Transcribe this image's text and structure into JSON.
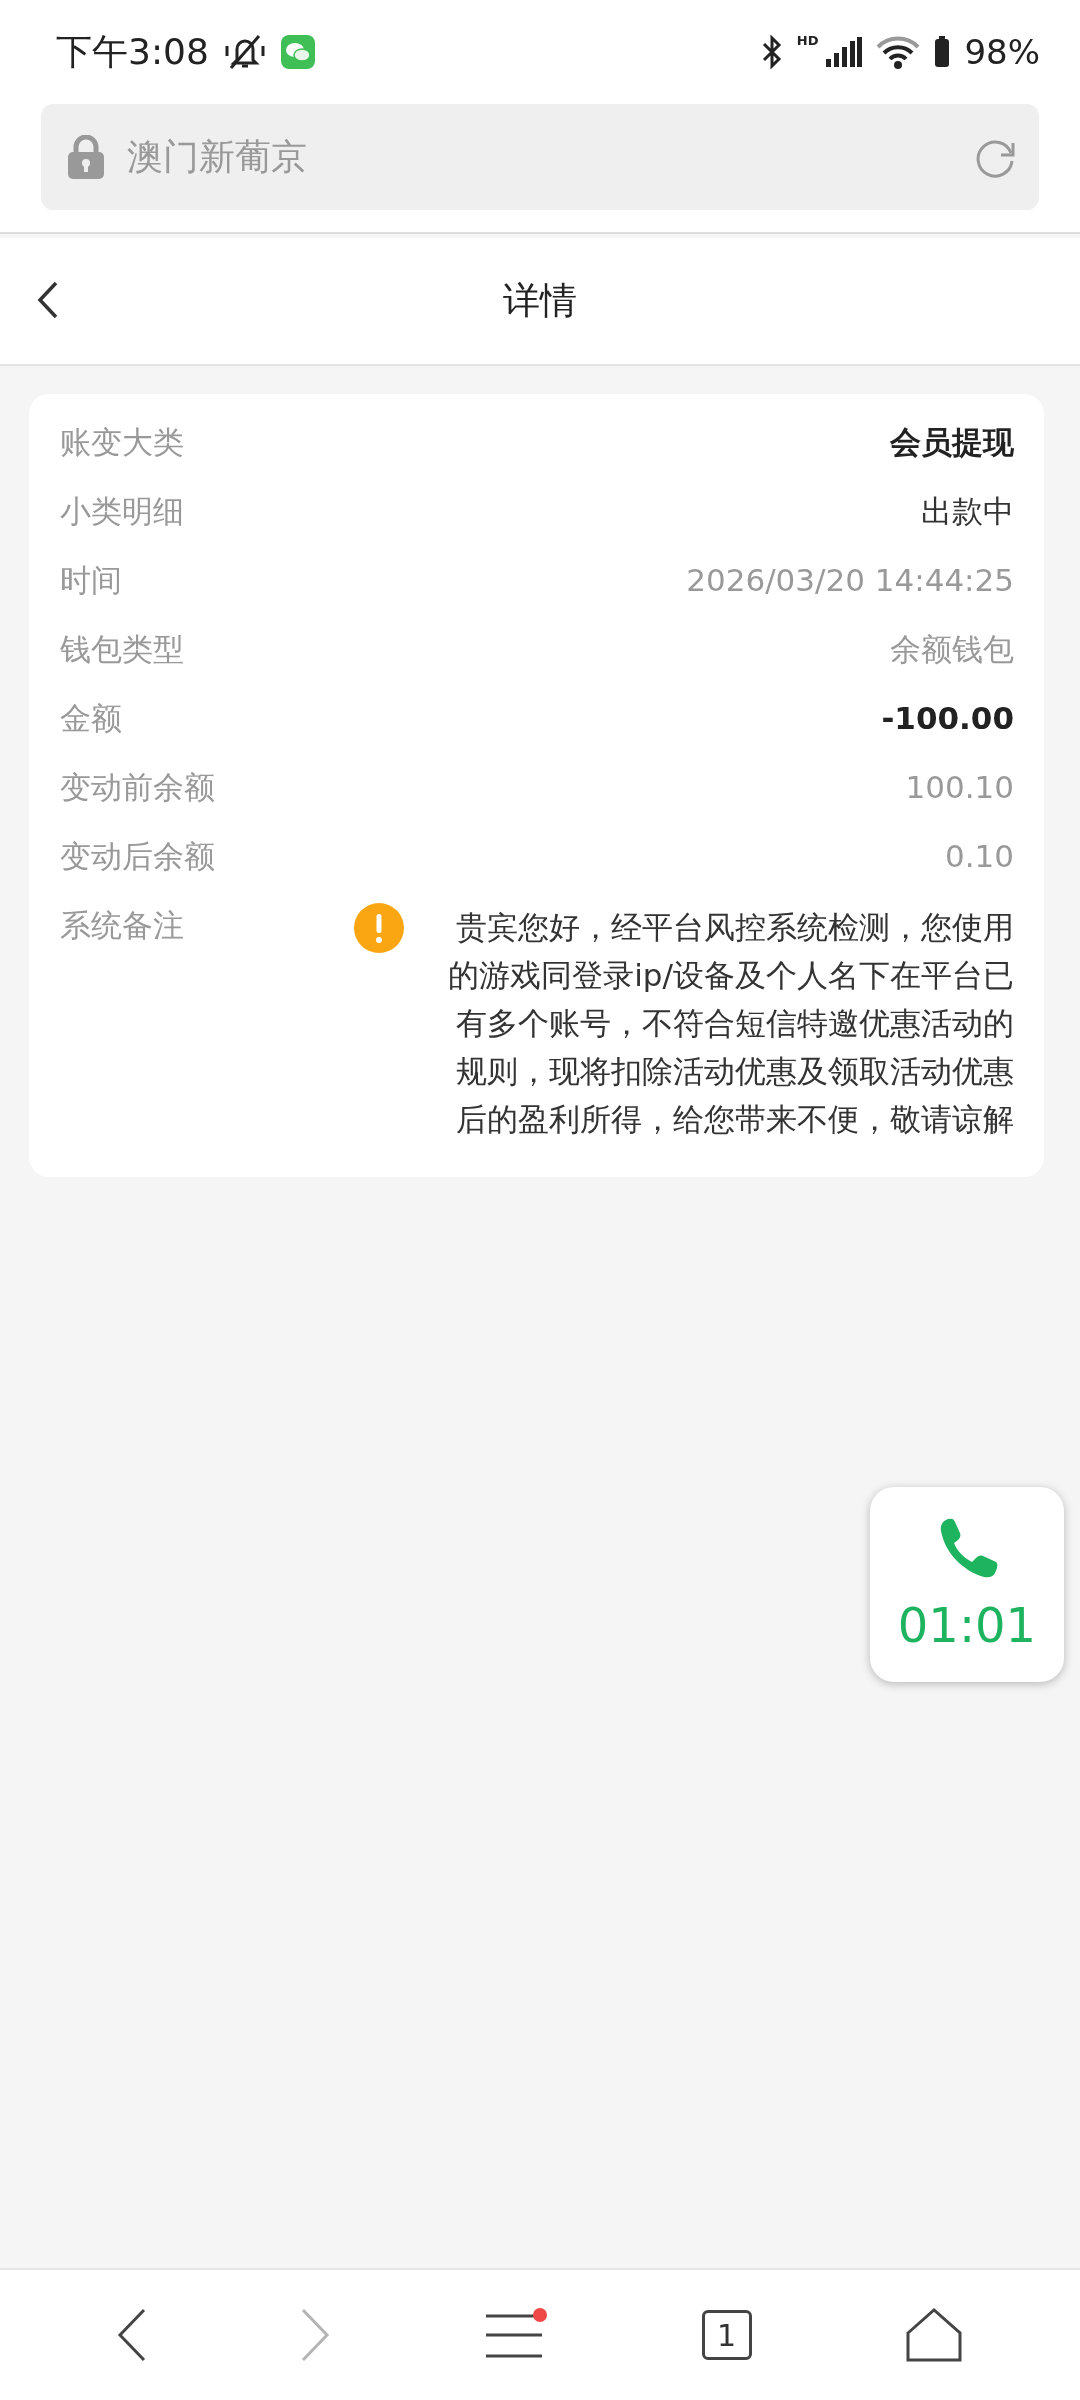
{
  "status_bar": {
    "time": "下午3:08",
    "network_label": "HD",
    "battery": "98%"
  },
  "address_bar": {
    "text": "澳门新葡京"
  },
  "header": {
    "title": "详情"
  },
  "details": [
    {
      "label": "账变大类",
      "value": "会员提现",
      "kind": "strong"
    },
    {
      "label": "小类明细",
      "value": "出款中",
      "kind": "plain"
    },
    {
      "label": "时间",
      "value": "2026/03/20 14:44:25",
      "kind": "muted"
    },
    {
      "label": "钱包类型",
      "value": "余额钱包",
      "kind": "muted"
    },
    {
      "label": "金额",
      "value": "-100.00",
      "kind": "strong"
    },
    {
      "label": "变动前余额",
      "value": "100.10",
      "kind": "muted"
    },
    {
      "label": "变动后余额",
      "value": "0.10",
      "kind": "muted"
    },
    {
      "label": "系统备注",
      "value": "贵宾您好，经平台风控系统检测，您使用的游戏同登录ip/设备及个人名下在平台已有多个账号，不符合短信特邀优惠活动的规则，现将扣除活动优惠及领取活动优惠后的盈利所得，给您带来不便，敬请谅解",
      "kind": "remark"
    }
  ],
  "call_widget": {
    "duration": "01:01"
  },
  "bottom_bar": {
    "back_disabled": false,
    "forward_disabled": true,
    "menu_notification": true,
    "tab_count": "1"
  }
}
